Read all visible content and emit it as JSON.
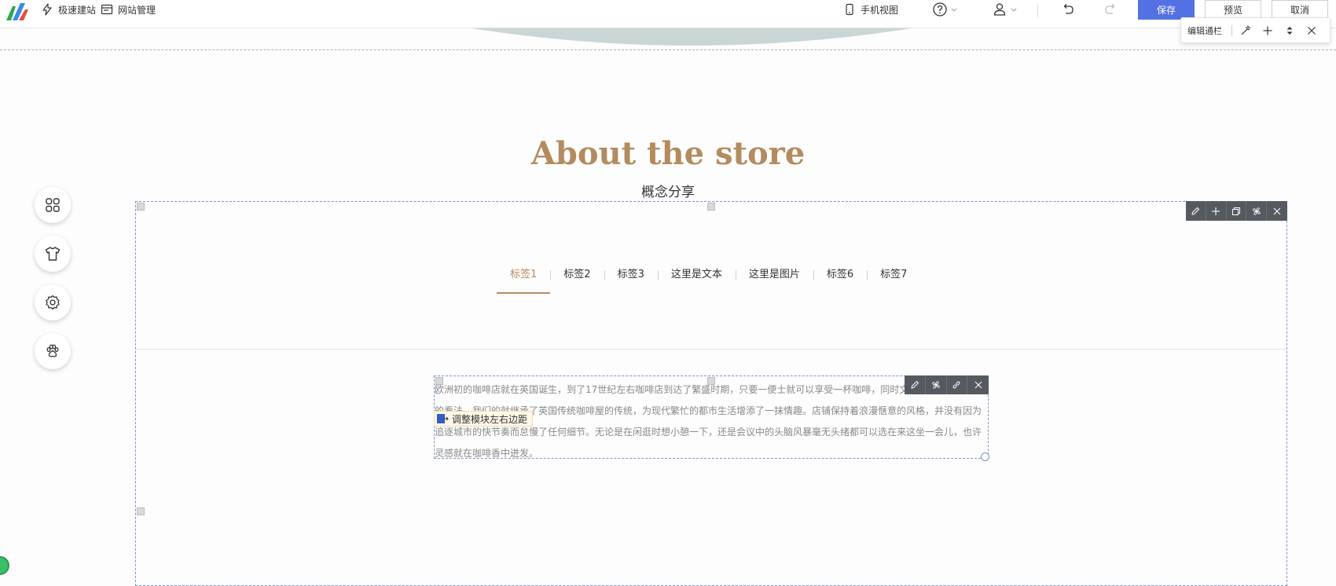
{
  "toolbar": {
    "quick_build": "极速建站",
    "site_manage": "网站管理",
    "mobile_view": "手机视图",
    "save": "保存",
    "preview": "预览",
    "cancel": "取消"
  },
  "editbar": {
    "label": "编辑通栏"
  },
  "page": {
    "title": "About the store",
    "subtitle": "概念分享"
  },
  "tabs": [
    {
      "label": "标签1",
      "active": true
    },
    {
      "label": "标签2",
      "active": false
    },
    {
      "label": "标签3",
      "active": false
    },
    {
      "label": "这里是文本",
      "active": false
    },
    {
      "label": "这里是图片",
      "active": false
    },
    {
      "label": "标签6",
      "active": false
    },
    {
      "label": "标签7",
      "active": false
    }
  ],
  "content": {
    "paragraph": "欧洲初的咖啡店就在英国诞生，到了17世纪左右咖啡店到达了繁盛时期，只要一便士就可以享受一杯咖啡，同时文化、经济等各方面的看法。我们的就继承了英国传统咖啡屋的传统，为现代繁忙的都市生活增添了一抹情趣。店铺保持着浪漫惬意的风格，并没有因为追逐城市的快节奏而怠慢了任何细节。无论是在闲逛时想小憩一下，还是会议中的头脑风暴毫无头绪都可以选在来这坐一会儿，也许灵感就在咖啡香中迸发。",
    "margin_tip": "调整模块左右边距"
  },
  "colors": {
    "accent": "#b38b5e",
    "primary_button": "#5371e2",
    "frame": "#7a94cc",
    "tool_bg": "#555a61"
  }
}
